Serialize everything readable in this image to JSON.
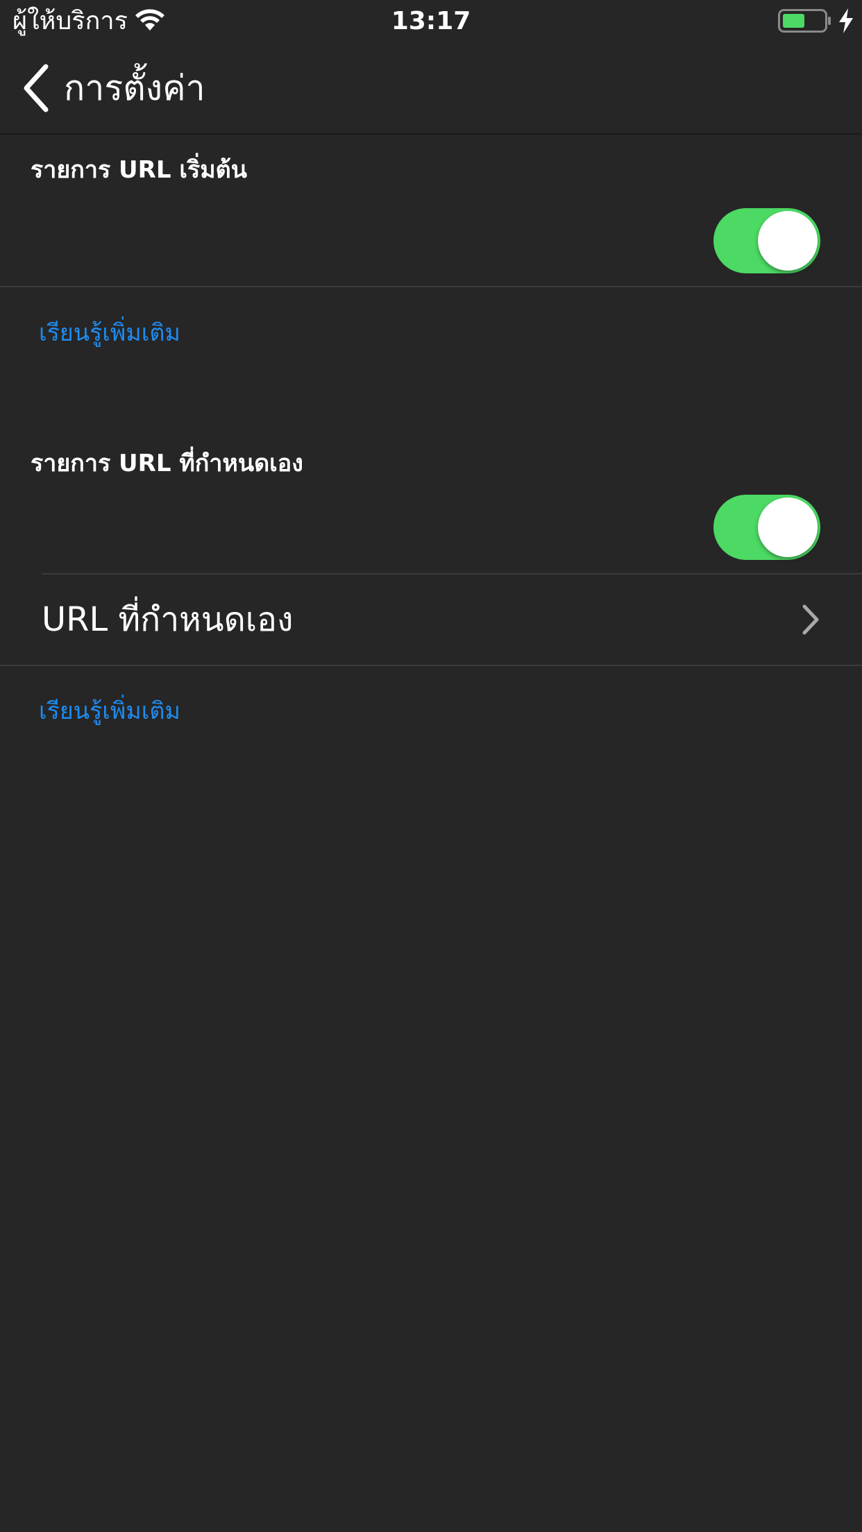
{
  "status_bar": {
    "carrier": "ผู้ให้บริการ",
    "time": "13:17",
    "battery_level": 0.55,
    "battery_color": "#4cd964",
    "wifi_icon": "wifi-icon",
    "charging_icon": "bolt-icon"
  },
  "nav": {
    "back_label": "การตั้งค่า",
    "back_icon": "chevron-left-icon"
  },
  "sections": {
    "default_list": {
      "header": "รายการ URL เริ่มต้น",
      "toggle_on": true,
      "learn_more": "เรียนรู้เพิ่มเติม"
    },
    "custom_list": {
      "header": "รายการ URL ที่กำหนดเอง",
      "toggle_on": true,
      "row_label": "URL ที่กำหนดเอง",
      "row_icon": "chevron-right-icon",
      "learn_more": "เรียนรู้เพิ่มเติม"
    }
  },
  "colors": {
    "background": "#262626",
    "accent_link": "#1e8bf0",
    "switch_on": "#4cd964"
  }
}
